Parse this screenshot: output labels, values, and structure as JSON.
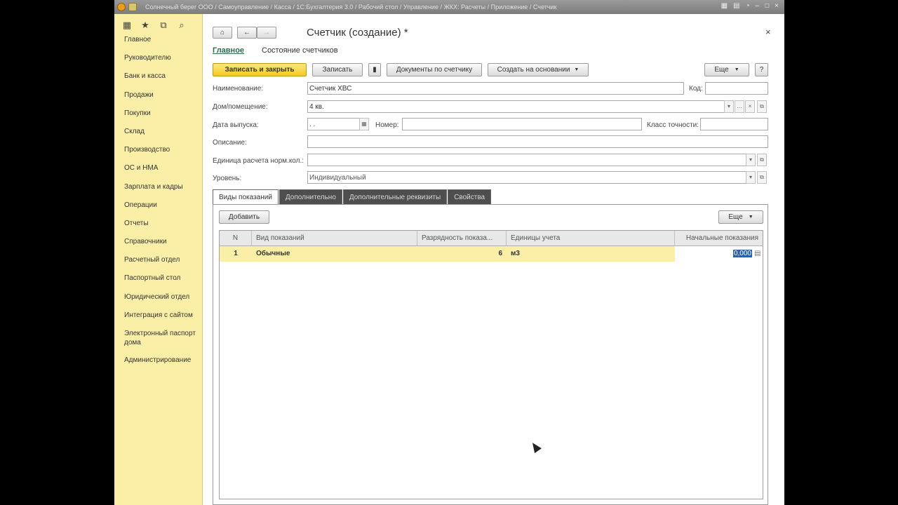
{
  "window": {
    "title": "Солнечный берег ООО / Самоуправление / Касса / 1С:Бухгалтерия 3.0 / Рабочий стол / Управление / ЖКХ: Расчеты / Приложение / Счетчик"
  },
  "sidebar": {
    "tools": [
      "grid-icon",
      "star-icon",
      "history-icon",
      "search-icon"
    ],
    "items": [
      {
        "label": "Главное"
      },
      {
        "label": "Руководителю"
      },
      {
        "label": "Банк и касса"
      },
      {
        "label": "Продажи"
      },
      {
        "label": "Покупки"
      },
      {
        "label": "Склад"
      },
      {
        "label": "Производство"
      },
      {
        "label": "ОС и НМА"
      },
      {
        "label": "Зарплата и кадры"
      },
      {
        "label": "Операции"
      },
      {
        "label": "Отчеты"
      },
      {
        "label": "Справочники"
      },
      {
        "label": "Расчетный отдел"
      },
      {
        "label": "Паспортный стол"
      },
      {
        "label": "Юридический отдел"
      },
      {
        "label": "Интеграция с сайтом"
      },
      {
        "label": "Электронный паспорт дома"
      },
      {
        "label": "Администрирование"
      }
    ]
  },
  "form": {
    "title": "Счетчик (создание) *",
    "close": "×",
    "nav_home_icon": "home-icon",
    "nav_back": "←",
    "nav_forward": "→",
    "links": {
      "main": "Главное",
      "meter_state": "Состояние счетчиков"
    },
    "toolbar": {
      "save_close": "Записать и закрыть",
      "save": "Записать",
      "documents": "Документы по счетчику",
      "create_based": "Создать на основании",
      "more": "Еще",
      "help": "?"
    },
    "fields": {
      "name_label": "Наименование:",
      "name_value": "Счетчик ХВС",
      "code_label": "Код:",
      "code_value": "",
      "house_label": "Дом/помещение:",
      "house_value": "4 кв.",
      "release_label": "Дата выпуска:",
      "release_value": "  .  .",
      "number_label": "Номер:",
      "number_value": "",
      "accuracy_label": "Класс точности:",
      "accuracy_value": "",
      "desc_label": "Описание:",
      "desc_value": "",
      "unit_label": "Единица расчета норм.кол.:",
      "unit_value": "",
      "level_label": "Уровень:",
      "level_value": "Индивидуальный"
    },
    "tabs": [
      {
        "label": "Виды показаний"
      },
      {
        "label": "Дополнительно"
      },
      {
        "label": "Дополнительные реквизиты"
      },
      {
        "label": "Свойства"
      }
    ],
    "table_toolbar": {
      "add": "Добавить",
      "more": "Еще"
    },
    "table": {
      "columns": [
        "N",
        "Вид показаний",
        "Разрядность показа...",
        "Единицы учета",
        "Начальные показания"
      ],
      "rows": [
        {
          "n": "1",
          "type": "Обычные",
          "digits": "6",
          "unit": "м3",
          "initial": "0,000"
        }
      ]
    }
  }
}
